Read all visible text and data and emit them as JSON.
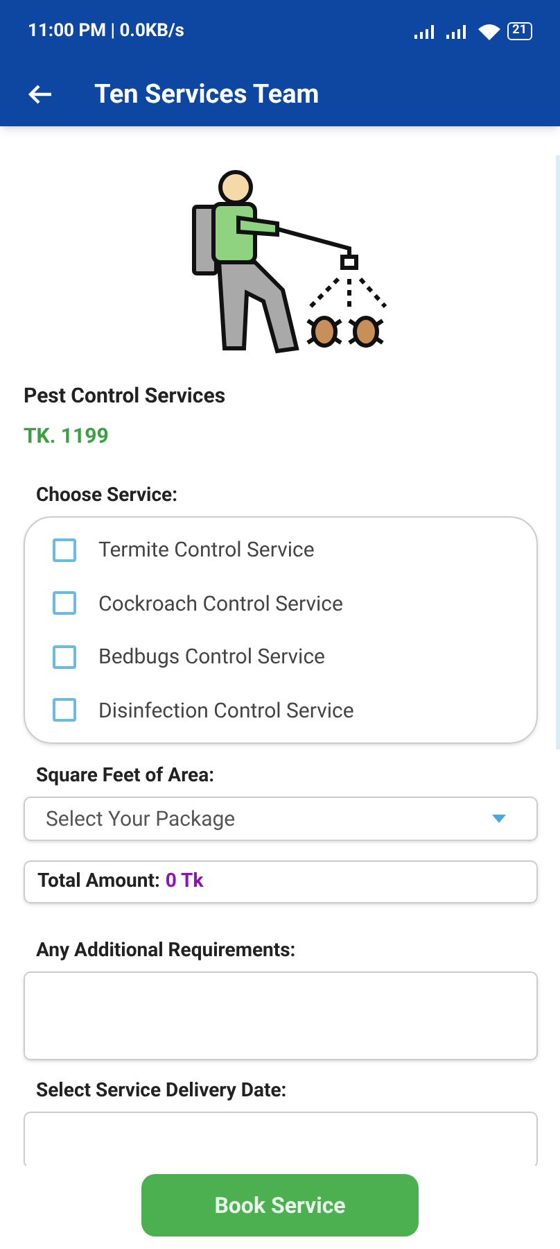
{
  "status_bar": {
    "time": "11:00 PM | 0.0KB/s",
    "battery": "21"
  },
  "app_bar": {
    "title": "Ten Services Team"
  },
  "service": {
    "name": "Pest Control Services",
    "price": "TK. 1199"
  },
  "choose_service": {
    "label": "Choose Service:",
    "options": [
      {
        "label": "Termite Control Service",
        "checked": false
      },
      {
        "label": "Cockroach Control Service",
        "checked": false
      },
      {
        "label": "Bedbugs Control Service",
        "checked": false
      },
      {
        "label": "Disinfection Control Service",
        "checked": false
      }
    ]
  },
  "area": {
    "label": "Square Feet of Area:",
    "placeholder": "Select Your Package"
  },
  "total": {
    "label": "Total Amount:",
    "value": "0 Tk"
  },
  "requirements": {
    "label": "Any Additional Requirements:"
  },
  "delivery_date": {
    "label": "Select Service Delivery Date:"
  },
  "book_button": {
    "label": "Book Service"
  }
}
